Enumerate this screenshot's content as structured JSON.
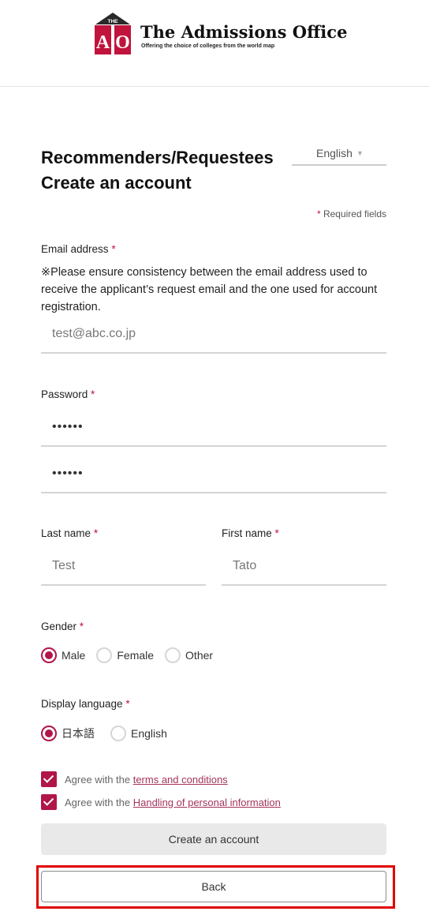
{
  "header": {
    "logo_letters": [
      "THE",
      "A",
      "O"
    ],
    "brand_name": "The Admissions Office",
    "tagline": "Offering the choice of colleges from the world map"
  },
  "form": {
    "title_line1": "Recommenders/Requestees",
    "title_line2": "Create an account",
    "language_select": {
      "value": "English"
    },
    "required_note": "Required fields",
    "required_mark": "*",
    "email": {
      "label": "Email address",
      "notice": "※Please ensure consistency between the email address used to receive the applicant’s request email and the one used for account registration.",
      "value": "test@abc.co.jp"
    },
    "password": {
      "label": "Password",
      "value": "••••••",
      "confirm_value": "••••••"
    },
    "last_name": {
      "label": "Last name",
      "value": "Test"
    },
    "first_name": {
      "label": "First name",
      "value": "Tato"
    },
    "gender": {
      "label": "Gender",
      "options": [
        "Male",
        "Female",
        "Other"
      ],
      "selected": "Male"
    },
    "display_language": {
      "label": "Display language",
      "options": [
        "日本語",
        "English"
      ],
      "selected": "日本語"
    },
    "agree_terms": {
      "prefix": "Agree with the ",
      "link": "terms and conditions",
      "checked": true
    },
    "agree_privacy": {
      "prefix": "Agree with the ",
      "link": "Handling of personal information",
      "checked": true
    },
    "create_button": "Create an account",
    "back_button": "Back"
  },
  "colors": {
    "accent": "#b01648",
    "logo_red": "#c0143c",
    "highlight": "#e00000"
  }
}
